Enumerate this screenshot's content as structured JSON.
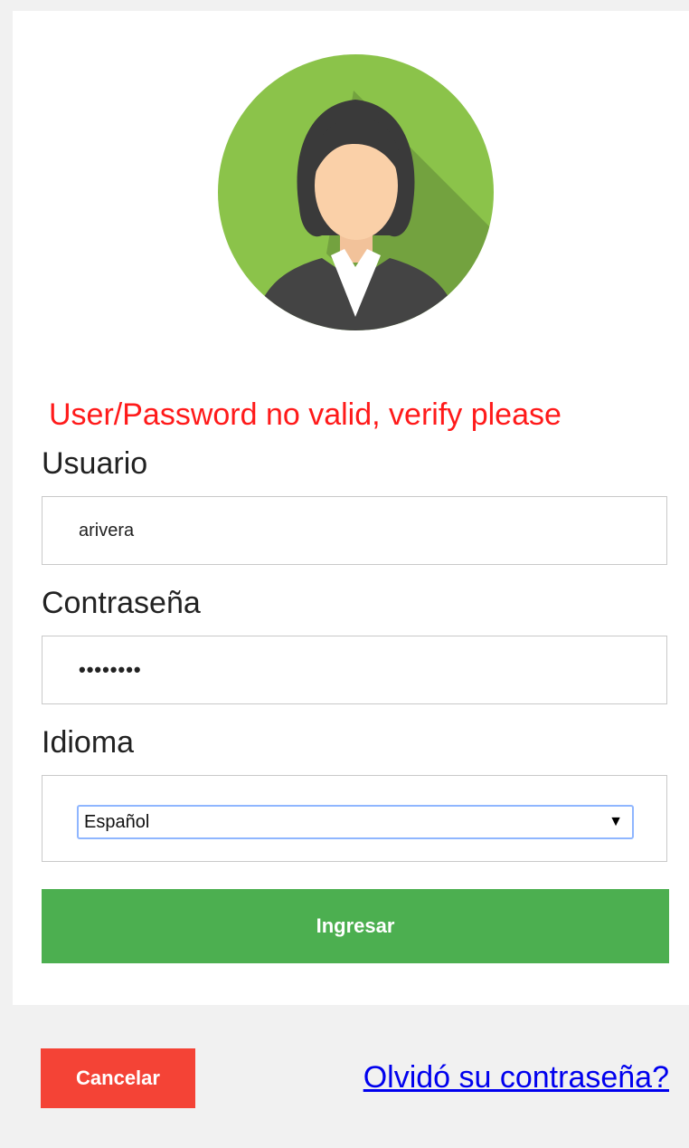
{
  "error_message": "User/Password no valid, verify please",
  "form": {
    "username_label": "Usuario",
    "username_value": "arivera",
    "password_label": "Contraseña",
    "password_mask": "••••••••",
    "language_label": "Idioma",
    "language_selected": "Español",
    "submit_label": "Ingresar"
  },
  "footer": {
    "cancel_label": "Cancelar",
    "forgot_link": "Olvidó su contraseña?"
  },
  "colors": {
    "error": "#ff1a1a",
    "submit": "#4caf50",
    "cancel": "#f44336",
    "link": "#0000ee",
    "avatar_bg": "#8bc34a"
  },
  "icons": {
    "avatar": "user-avatar-icon",
    "select_arrow": "triangle-down-icon"
  }
}
